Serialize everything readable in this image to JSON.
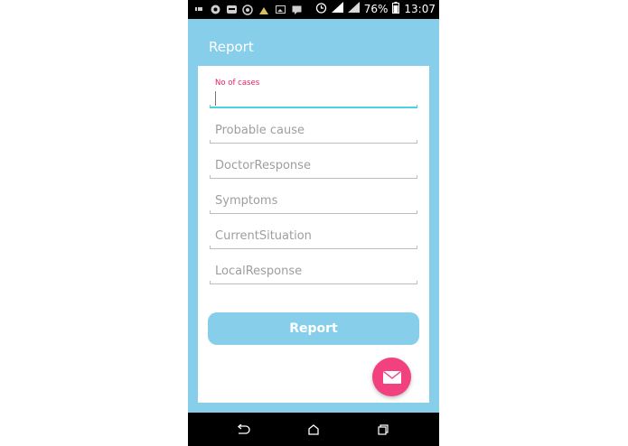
{
  "status_bar": {
    "battery": "76%",
    "time": "13:07",
    "icons": [
      "usb-icon",
      "notification-icon",
      "hike-icon",
      "whatsapp-icon",
      "tools-icon",
      "image-icon",
      "message-icon",
      "alarm-icon",
      "signal-icon",
      "signal-icon",
      "battery-icon"
    ]
  },
  "app_bar": {
    "title": "Report"
  },
  "form": {
    "fields": [
      {
        "label": "No of cases",
        "value": "",
        "placeholder": "",
        "active": true
      },
      {
        "label": "",
        "value": "",
        "placeholder": "Probable cause"
      },
      {
        "label": "",
        "value": "",
        "placeholder": "DoctorResponse"
      },
      {
        "label": "",
        "value": "",
        "placeholder": "Symptoms"
      },
      {
        "label": "",
        "value": "",
        "placeholder": "CurrentSituation"
      },
      {
        "label": "",
        "value": "",
        "placeholder": "LocalResponse"
      }
    ],
    "submit_label": "Report"
  },
  "fab": {
    "icon": "mail-icon"
  },
  "nav_bar": {
    "icons": [
      "back-icon",
      "home-icon",
      "recents-icon"
    ]
  },
  "colors": {
    "primary": "#87ceeb",
    "accent": "#f2417f",
    "field_label": "#e91e63",
    "active_underline": "#4dd0e1"
  }
}
